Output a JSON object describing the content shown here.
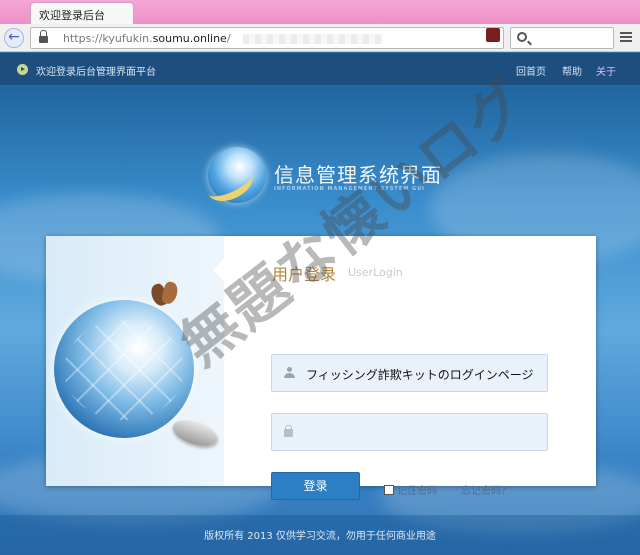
{
  "browser": {
    "tab_title": "欢迎登录后台",
    "url_prefix": "https://kyufukin.",
    "url_host": "soumu.online",
    "url_rest": "/",
    "search_placeholder": ""
  },
  "topbar": {
    "welcome": "欢迎登录后台管理界面平台",
    "links": [
      "回首页",
      "帮助",
      "关于"
    ],
    "accent": "#c8d98f"
  },
  "logo": {
    "title": "信息管理系统界面",
    "subtitle": "INFORMATION MANAGEMENT SYSTEM GUI"
  },
  "login": {
    "title": "用户登录",
    "title_en": "UserLogin",
    "username_value": "フィッシング詐欺キットのログインページ",
    "password_value": "",
    "login_button": "登录",
    "remember_label": "记住密码",
    "forgot_label": "忘记密码？",
    "button_color": "#2d7fc4"
  },
  "footer": {
    "copyright": "版权所有 2013 仅供学习交流，勿用于任何商业用途"
  },
  "watermark": "無題な懐いログ"
}
